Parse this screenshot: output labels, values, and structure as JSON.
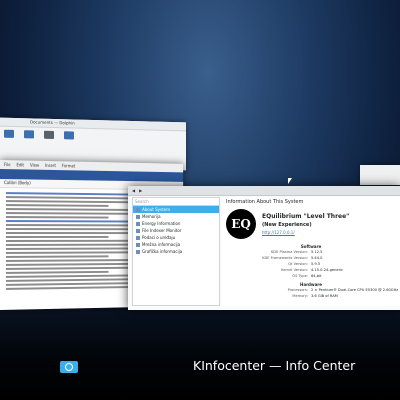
{
  "files_window": {
    "title": "Documents — Dolphin"
  },
  "doc_window": {
    "menu": [
      "File",
      "Edit",
      "View",
      "Insert",
      "Format"
    ],
    "font_name": "Calibri (Body)"
  },
  "info_window": {
    "title": "Information About This System",
    "search_placeholder": "Search",
    "modules": [
      {
        "label": "About System",
        "selected": true
      },
      {
        "label": "Memorija",
        "selected": false
      },
      {
        "label": "Energy Information",
        "selected": false
      },
      {
        "label": "File Indexer Monitor",
        "selected": false
      },
      {
        "label": "Podaci o uređaju",
        "selected": false
      },
      {
        "label": "Mrežna informacija",
        "selected": false
      },
      {
        "label": "Grafička informacija",
        "selected": false
      }
    ],
    "distro_name": "EQuilibrium \"Level Three\"",
    "distro_edition": "(New Experience)",
    "distro_url": "http://127.0.0.1/",
    "software_heading": "Software",
    "software": [
      {
        "k": "KDE Plasma Version:",
        "v": "5.12.5"
      },
      {
        "k": "KDE Frameworks Version:",
        "v": "5.44.0"
      },
      {
        "k": "Qt Version:",
        "v": "5.9.5"
      },
      {
        "k": "Kernel Version:",
        "v": "4.15.0-24-generic"
      },
      {
        "k": "OS Type:",
        "v": "64-bit"
      }
    ],
    "hardware_heading": "Hardware",
    "hardware": [
      {
        "k": "Processors:",
        "v": "2 × Pentium® Dual-Core CPU E5300 @ 2.60GHz"
      },
      {
        "k": "Memory:",
        "v": "3.6 GiB of RAM"
      }
    ]
  },
  "switcher": {
    "label": "KInfocenter — Info Center"
  }
}
